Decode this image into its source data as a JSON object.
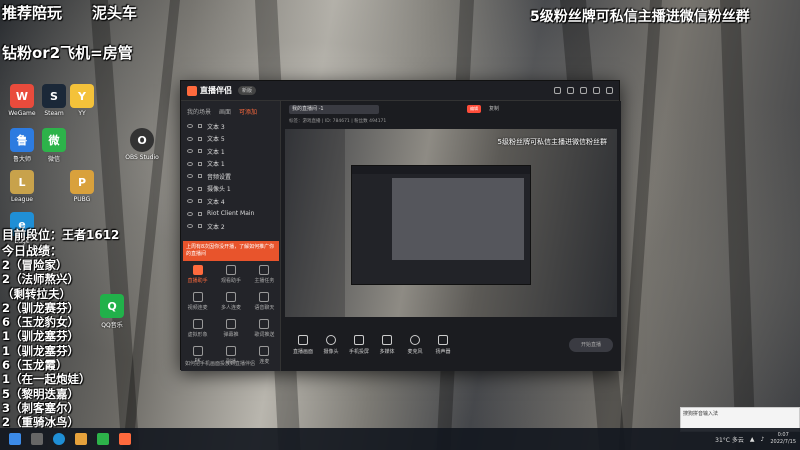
{
  "overlays": {
    "top_left": "推荐陪玩",
    "top_left2": "泥头车",
    "top_center_right": "5级粉丝牌可私信主播进微信粉丝群",
    "line2": "钻粉or2飞机=房管",
    "rank_title": "目前段位：王者1612",
    "record_title": "今日战绩：",
    "records": [
      "2（冒险家）",
      "2（法师熬兴）",
      "（剩转拉夫）",
      "2（驯龙赛芬）",
      "6（玉龙豹女）",
      "1（驯龙塞芬）",
      "1（驯龙塞芬）",
      "6（玉龙霞）",
      "1（在一起炮娃）",
      "5（黎明迭嘉）",
      "3（刺客塞尔）",
      "2（重骑冰鸟）"
    ]
  },
  "desktop_icons": [
    {
      "label": "WeGame",
      "color": "#e94b3c",
      "glyph": "W"
    },
    {
      "label": "Steam",
      "color": "#1b2838",
      "glyph": "S"
    },
    {
      "label": "鲁大师",
      "color": "#2d7be0",
      "glyph": "鲁"
    },
    {
      "label": "微信",
      "color": "#2db34a",
      "glyph": "微"
    },
    {
      "label": "League",
      "color": "#c8a24b",
      "glyph": "L"
    },
    {
      "label": "PUBG",
      "color": "#d9a13c",
      "glyph": "P"
    },
    {
      "label": "Edge",
      "color": "#1f8fd6",
      "glyph": "e"
    },
    {
      "label": "YY",
      "color": "#f4c23a",
      "glyph": "Y"
    },
    {
      "label": "OBS Studio",
      "color": "#333",
      "glyph": "O"
    },
    {
      "label": "QQ音乐",
      "color": "#21b14a",
      "glyph": "Q"
    }
  ],
  "app": {
    "title": "直播伴侣",
    "version": "新版",
    "tabs": [
      "我的场景",
      "画面",
      "可添加"
    ],
    "scenes": [
      "文本 3",
      "文本 5",
      "文本 1",
      "文本 1",
      "音频设置",
      "摄像头 1",
      "文本 4",
      "Riot Client Main",
      "文本 2"
    ],
    "tip": "上周有8次因你没开播，了解如何推广你的直播间",
    "tools": [
      "直播助手",
      "观看助手",
      "主播任务",
      "视频连麦",
      "多人连麦",
      "语音聊天",
      "虚拟形象",
      "弹幕推",
      "歌词推送",
      "PK",
      "副播",
      "连麦"
    ],
    "bottom_tip": "如何把手机画面投放到直播伴侣",
    "live_name": "我的直播间 -1",
    "edit_label": "编辑",
    "share_label": "复制",
    "meta": "标签：游戏直播  |  ID: 784671  |  粉丝数 494171",
    "preview_text": "5级粉丝牌可私信主播进微信粉丝群",
    "controls": [
      "直播画面",
      "摄像头",
      "手机投屏",
      "多媒体",
      "麦克风",
      "扬声器"
    ],
    "start_label": "开始直播"
  },
  "taskbar": {
    "weather": "31°C 多云",
    "time": "0:07",
    "date": "2022/7/15"
  },
  "ime": "搜狗拼音输入法"
}
